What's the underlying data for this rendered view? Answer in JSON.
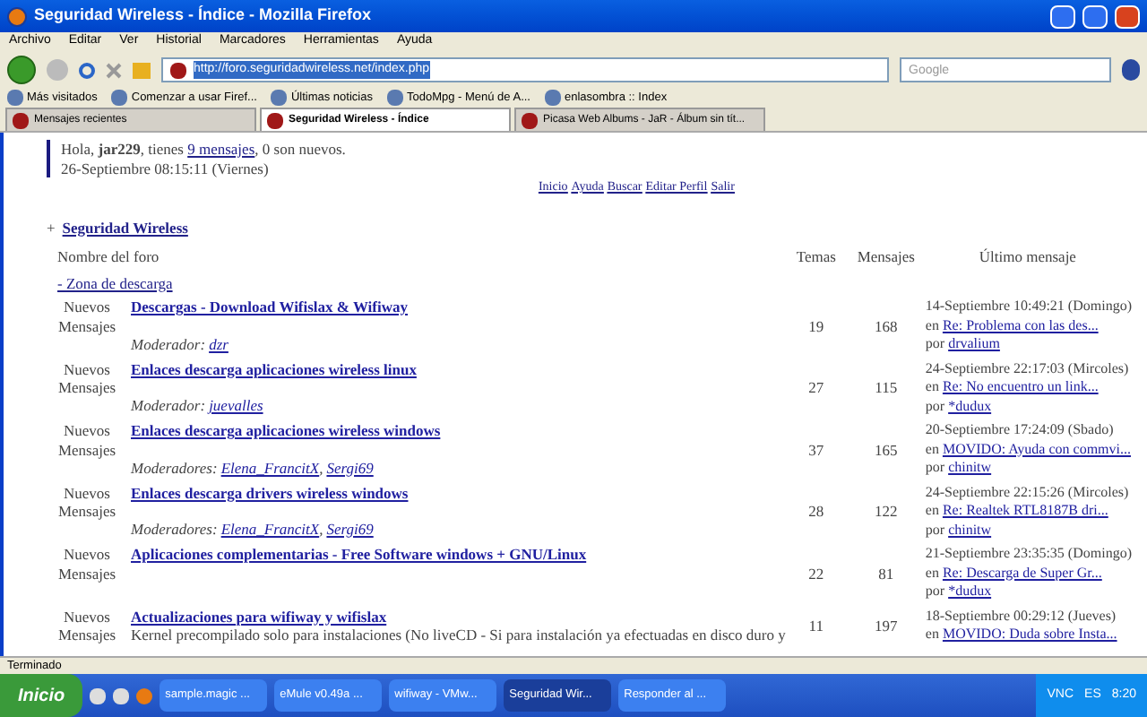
{
  "window": {
    "title": "Seguridad Wireless - Índice - Mozilla Firefox"
  },
  "menu": [
    "Archivo",
    "Editar",
    "Ver",
    "Historial",
    "Marcadores",
    "Herramientas",
    "Ayuda"
  ],
  "address_bar": {
    "value": "http://foro.seguridadwireless.net/index.php"
  },
  "search": {
    "placeholder": "Google"
  },
  "bookmarks": [
    "Más visitados",
    "Comenzar a usar Firef...",
    "Últimas noticias",
    "TodoMpg - Menú de A...",
    "enlasombra :: Index"
  ],
  "tabs": [
    {
      "label": "Mensajes recientes",
      "selected": false
    },
    {
      "label": "Seguridad Wireless - Índice",
      "selected": true
    },
    {
      "label": "Picasa Web Albums - JaR - Álbum sin tít...",
      "selected": false
    }
  ],
  "greeting": {
    "text": "Hola, **jar229**, tienes ",
    "link": "9 mensajes",
    "rest": ", 0 son nuevos.",
    "date": "26-Septiembre 08:15:11 (Viernes)"
  },
  "nav_links": [
    "Inicio",
    "Ayuda",
    "Buscar",
    "Editar Perfil",
    "Salir"
  ],
  "category": {
    "toggle": "+",
    "title": "Seguridad Wireless"
  },
  "columns": [
    "Nombre del foro",
    "Temas",
    "Mensajes",
    "Último mensaje"
  ],
  "zone": "- Zona de descarga",
  "moderator_separator": ",",
  "forums": [
    {
      "status": "Nuevos Mensajes",
      "title": "Descargas - Download Wifislax & Wifiway",
      "moderator_label": "Moderador:",
      "moderators": [
        "dzr"
      ],
      "topics": "19",
      "posts": "168",
      "last_date": "14-Septiembre 10:49:21 (Domingo)",
      "last_in": "en",
      "last_topic": "Re: Problema con las des...",
      "last_by_label": "por",
      "last_by": "drvalium"
    },
    {
      "status": "Nuevos Mensajes",
      "title": "Enlaces descarga aplicaciones wireless linux",
      "moderator_label": "Moderador:",
      "moderators": [
        "juevalles"
      ],
      "topics": "27",
      "posts": "115",
      "last_date": "24-Septiembre 22:17:03 (Mircoles)",
      "last_in": "en",
      "last_topic": "Re: No encuentro un link...",
      "last_by_label": "por",
      "last_by": "*dudux"
    },
    {
      "status": "Nuevos Mensajes",
      "title": "Enlaces descarga aplicaciones wireless windows",
      "moderator_label": "Moderadores:",
      "moderators": [
        "Elena_FrancitX",
        "Sergi69"
      ],
      "topics": "37",
      "posts": "165",
      "last_date": "20-Septiembre 17:24:09 (Sbado)",
      "last_in": "en",
      "last_topic": "MOVIDO: Ayuda con commvi...",
      "last_by_label": "por",
      "last_by": "chinitw"
    },
    {
      "status": "Nuevos Mensajes",
      "title": "Enlaces descarga drivers wireless windows",
      "moderator_label": "Moderadores:",
      "moderators": [
        "Elena_FrancitX",
        "Sergi69"
      ],
      "topics": "28",
      "posts": "122",
      "last_date": "24-Septiembre 22:15:26 (Mircoles)",
      "last_in": "en",
      "last_topic": "Re: Realtek RTL8187B dri...",
      "last_by_label": "por",
      "last_by": "chinitw"
    },
    {
      "status": "Nuevos Mensajes",
      "title": "Aplicaciones complementarias - Free Software windows + GNU/Linux",
      "topics": "22",
      "posts": "81",
      "last_date": "21-Septiembre 23:35:35 (Domingo)",
      "last_in": "en",
      "last_topic": "Re: Descarga de Super Gr...",
      "last_by_label": "por",
      "last_by": "*dudux"
    },
    {
      "status": "Nuevos Mensajes",
      "title": "Actualizaciones para wifiway y wifislax",
      "description": "Kernel precompilado solo para instalaciones (No liveCD - Si para instalación ya efectuadas en disco duro y",
      "topics": "11",
      "posts": "197",
      "last_date": "18-Septiembre 00:29:12 (Jueves)",
      "last_in": "en",
      "last_topic": "MOVIDO: Duda sobre Insta..."
    }
  ],
  "status_bar": "Terminado",
  "taskbar": {
    "start": "Inicio",
    "tasks": [
      {
        "label": "sample.magic ...",
        "selected": false
      },
      {
        "label": "eMule v0.49a ...",
        "selected": false
      },
      {
        "label": "wifiway - VMw...",
        "selected": false
      },
      {
        "label": "Seguridad Wir...",
        "selected": true
      },
      {
        "label": "Responder al ...",
        "selected": false
      }
    ],
    "tray_items": [
      "VNC",
      "ES"
    ],
    "clock": "8:20"
  }
}
